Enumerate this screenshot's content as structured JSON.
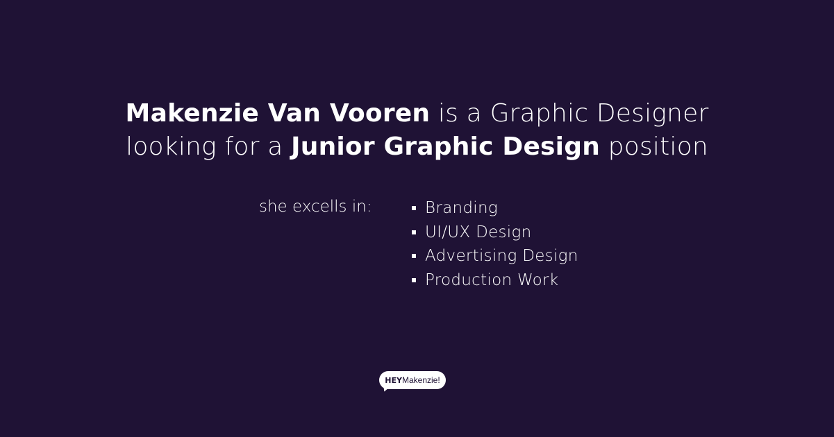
{
  "headline": {
    "line1": {
      "name": "Makenzie Van Vooren",
      "rest": " is a Graphic Designer"
    },
    "line2": {
      "start": "looking for a ",
      "role": "Junior Graphic Design",
      "end": " position"
    }
  },
  "skills": {
    "label": "she excells in:",
    "items": [
      {
        "label": "Branding"
      },
      {
        "label": "UI/UX Design"
      },
      {
        "label": "Advertising Design"
      },
      {
        "label": "Production Work"
      }
    ]
  },
  "logo": {
    "hey": "HEY",
    "name": "Makenzie!"
  },
  "colors": {
    "background": "#1f1235",
    "text": "#ffffff"
  }
}
